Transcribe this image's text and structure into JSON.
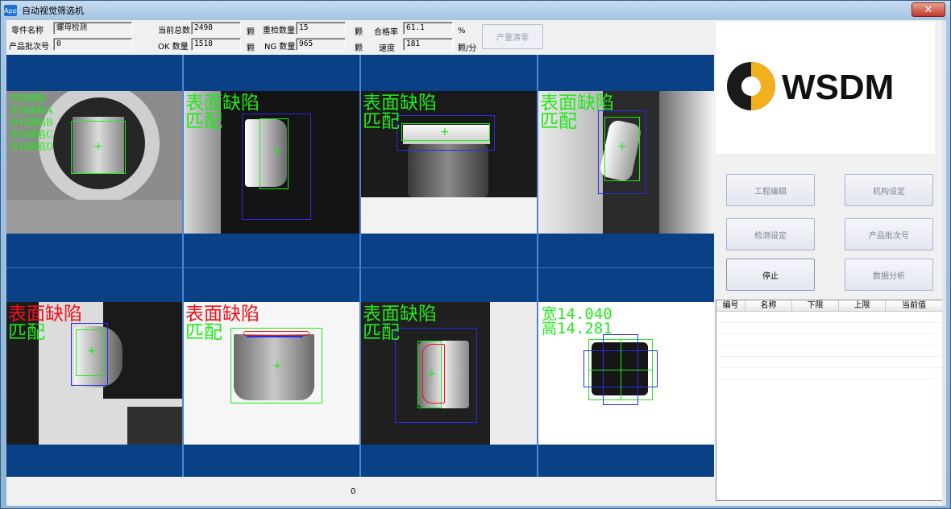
{
  "window": {
    "icon_text": "App",
    "title": "自动视觉筛选机",
    "close_label": "✕"
  },
  "info": {
    "part_name_label": "零件名称",
    "part_name_value": "螺母检测",
    "batch_label": "产品批次号",
    "batch_value": "0",
    "total_label": "当前总数",
    "total_value": "2498",
    "total_unit": "颗",
    "ok_label": "OK 数量",
    "ok_value": "1518",
    "ok_unit": "颗",
    "recheck_label": "重检数量",
    "recheck_value": "15",
    "recheck_unit": "颗",
    "ng_label": "NG 数量",
    "ng_value": "965",
    "ng_unit": "颗",
    "pass_rate_label": "合格率",
    "pass_rate_value": "61.1",
    "pass_rate_unit": "%",
    "speed_label": "速度",
    "speed_value": "181",
    "speed_unit": "颗/分",
    "clear_button": "产量清零"
  },
  "cameras": {
    "c1": {
      "lines": [
        "内R缺陷",
        "外R缺陷A",
        "外R缺陷B",
        "外R缺陷C",
        "外R缺陷D"
      ]
    },
    "c2": {
      "line1": "表面缺陷",
      "line2": "匹配"
    },
    "c3": {
      "line1": "表面缺陷",
      "line2": "匹配"
    },
    "c4": {
      "line1": "表面缺陷",
      "line2": "匹配"
    },
    "c5": {
      "line1": "表面缺陷",
      "line2": "匹配"
    },
    "c6": {
      "line1": "表面缺陷",
      "line2": "匹配"
    },
    "c7": {
      "line1": "表面缺陷",
      "line2": "匹配"
    },
    "c8": {
      "line1": "宽14.040",
      "line2": "高14.281"
    }
  },
  "status_value": "0",
  "logo_text": "WSDM",
  "buttons": {
    "project_edit": "工程编辑",
    "mechanism": "机构设定",
    "detection": "检测设定",
    "batch": "产品批次号",
    "stop": "停止",
    "analysis": "数据分析"
  },
  "table": {
    "headers": [
      "编号",
      "名称",
      "下限",
      "上限",
      "当前值"
    ]
  }
}
